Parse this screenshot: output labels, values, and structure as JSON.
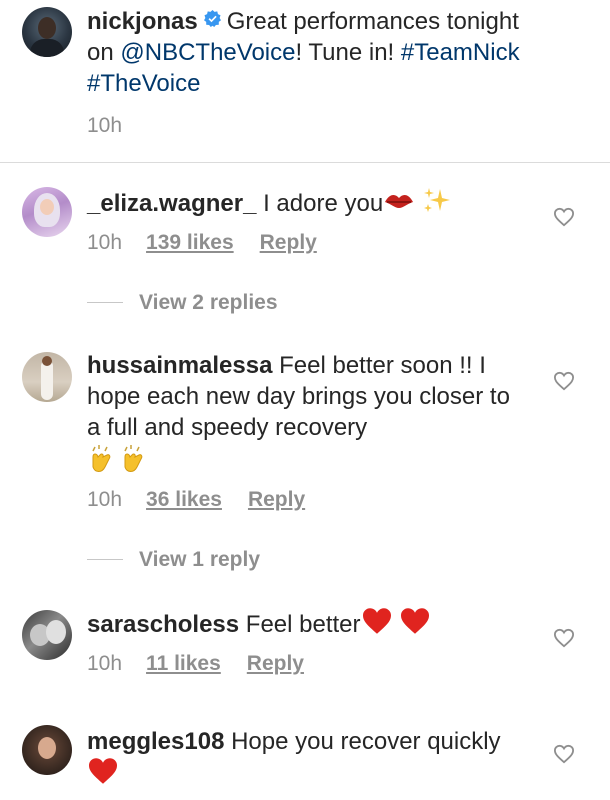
{
  "caption": {
    "username": "nickjonas",
    "text_parts": [
      "Great performances tonight on ",
      "@NBCTheVoice",
      "! Tune in! ",
      "#TeamNick",
      " ",
      "#TheVoice"
    ],
    "time": "10h"
  },
  "comments": [
    {
      "username": "_eliza.wagner_",
      "text": "I adore you",
      "emojis": [
        "kiss-mark",
        "sparkles"
      ],
      "time": "10h",
      "likes": "139 likes",
      "reply": "Reply",
      "view_replies": "View 2 replies"
    },
    {
      "username": "hussainmalessa",
      "text": "Feel better soon !! I hope each new day brings you closer to a full and speedy recovery",
      "emojis": [
        "clapping-hands",
        "clapping-hands"
      ],
      "time": "10h",
      "likes": "36 likes",
      "reply": "Reply",
      "view_replies": "View 1 reply"
    },
    {
      "username": "sarascholess",
      "text": "Feel better",
      "emojis": [
        "red-heart",
        "red-heart"
      ],
      "time": "10h",
      "likes": "11 likes",
      "reply": "Reply"
    },
    {
      "username": "meggles108",
      "text": "Hope you recover quickly",
      "emojis": [
        "red-heart"
      ]
    }
  ],
  "colors": {
    "text": "#262626",
    "secondary": "#8e8e8e",
    "link": "#00376b",
    "verified": "#3897f0",
    "divider": "#dbdbdb",
    "emoji_heart": "#e0241f"
  }
}
